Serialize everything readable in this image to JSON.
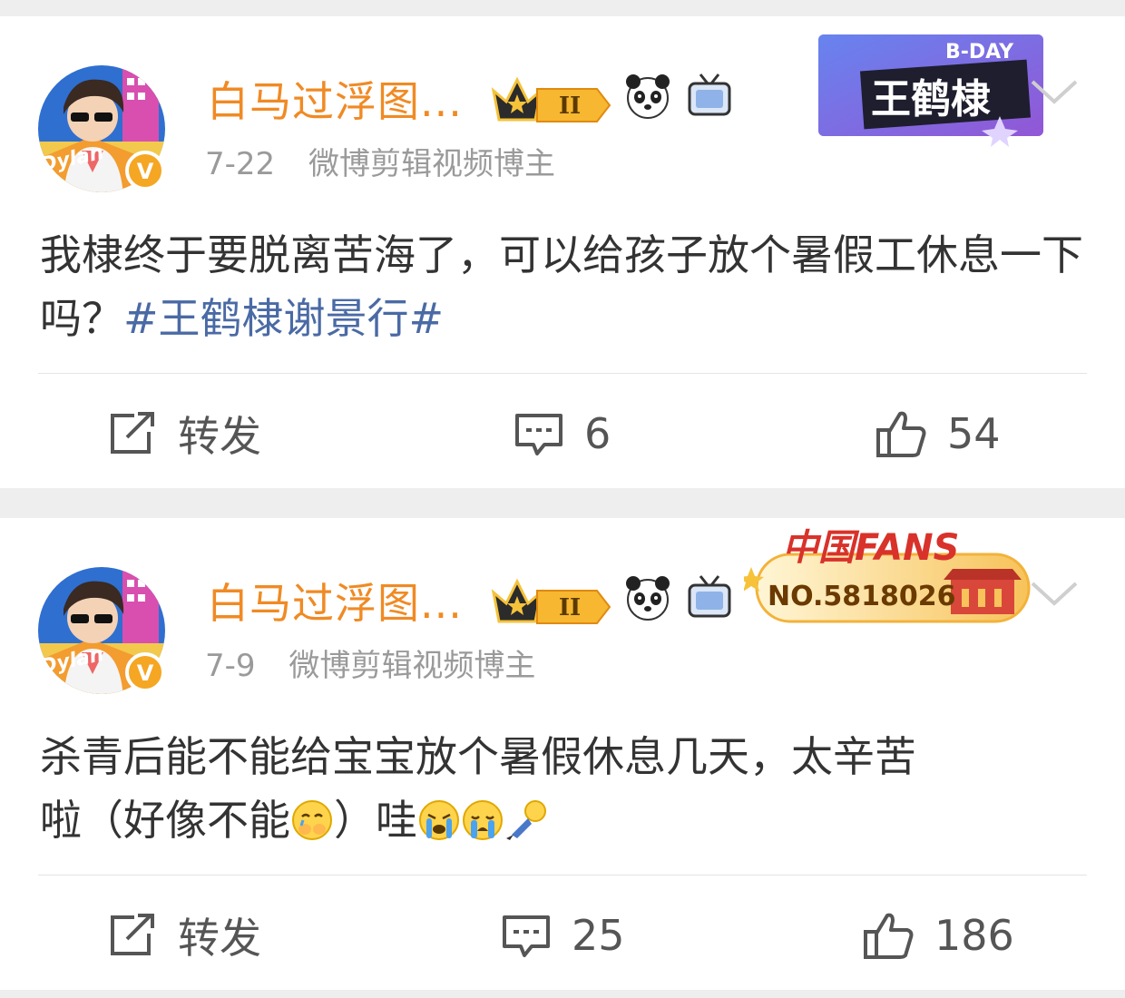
{
  "posts": [
    {
      "username": "白马过浮图...",
      "date": "7-22",
      "source": "微博剪辑视频博主",
      "text": "我棣终于要脱离苦海了，可以给孩子放个暑假工休息一下吗？",
      "hashtag": "#王鹤棣谢景行#",
      "badge_level": "II",
      "decor_label": "B-DAY",
      "decor_name": "王鹤棣",
      "repost_label": "转发",
      "comment_count": "6",
      "like_count": "54"
    },
    {
      "username": "白马过浮图...",
      "date": "7-9",
      "source": "微博剪辑视频博主",
      "text_line1": "杀青后能不能给宝宝放个暑假休息几天，太辛苦",
      "text_part2": "啦（好像不能",
      "text_part3": "）哇",
      "badge_level": "II",
      "decor_title": "中国FANS",
      "decor_number": "NO.5818026",
      "repost_label": "转发",
      "comment_count": "25",
      "like_count": "186"
    }
  ],
  "colors": {
    "username": "#f08a24",
    "meta": "#9a9a9a",
    "hashtag": "#4a6aa5",
    "action": "#555555",
    "background": "#eeeeee"
  },
  "icons": [
    "avatar",
    "crown-badge-icon",
    "panda-icon",
    "tv-icon",
    "chevron-down-icon",
    "repost-icon",
    "comment-icon",
    "like-icon",
    "verified-icon"
  ]
}
